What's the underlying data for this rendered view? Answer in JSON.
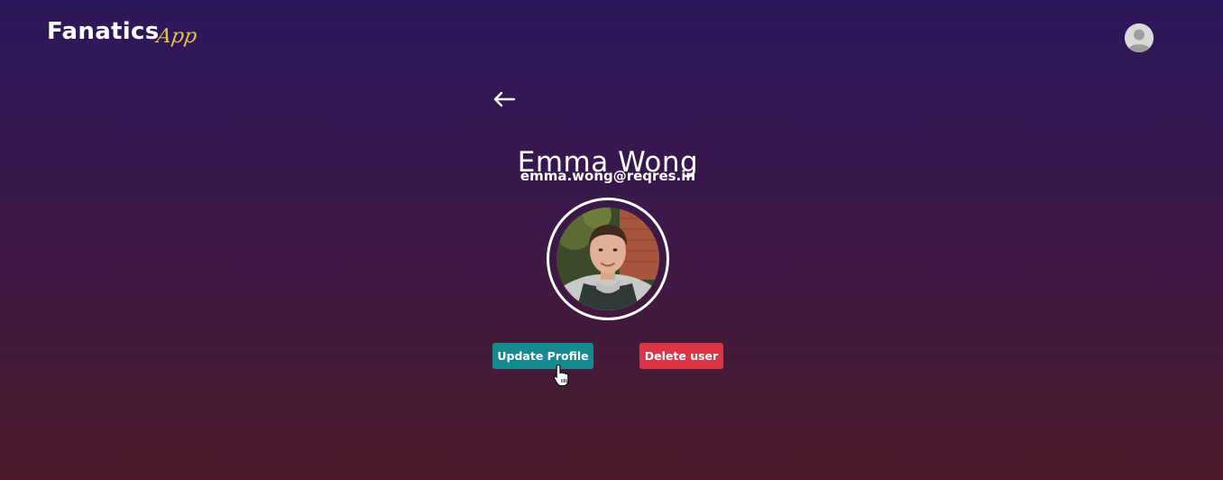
{
  "header": {
    "logo_main": "Fanatics",
    "logo_script": "App",
    "avatar_icon": "user-avatar-icon"
  },
  "nav": {
    "back_icon": "arrow-left-icon"
  },
  "profile": {
    "name": "Emma Wong",
    "email": "emma.wong@reqres.in",
    "photo_alt": "Emma Wong"
  },
  "actions": {
    "update_label": "Update Profile",
    "delete_label": "Delete user"
  },
  "colors": {
    "background_top": "#2c175c",
    "background_bottom": "#4d1b2b",
    "update_button": "#158a8f",
    "delete_button": "#dc3545",
    "logo_script": "#e3c24a"
  }
}
